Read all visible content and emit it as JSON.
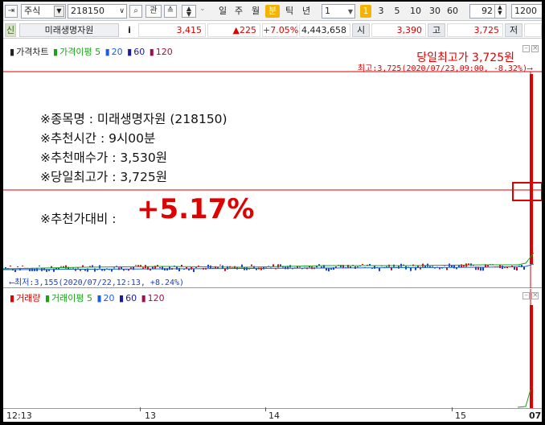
{
  "toolbar": {
    "market_type": "주식",
    "stock_code": "218150",
    "btn_gwan": "관",
    "periods": [
      "일",
      "주",
      "월",
      "분",
      "틱",
      "년"
    ],
    "active_period": "분",
    "interval_value": "1",
    "intervals": [
      "1",
      "3",
      "5",
      "10",
      "30",
      "60"
    ],
    "active_interval": "1",
    "zoom_value": "92",
    "count_value": "1200"
  },
  "quote": {
    "badge": "신",
    "stock_name": "미래생명자원",
    "info_icon": "i",
    "current_price": "3,415",
    "change": "▲225",
    "change_pct": "+7.05%",
    "volume": "4,443,658",
    "open_label": "시",
    "open_price": "3,390",
    "high_label": "고",
    "high_price": "3,725",
    "low_label": "저"
  },
  "price_pane": {
    "legend": [
      {
        "text": "가격차트",
        "color": "#222222"
      },
      {
        "text": "가격이평 5",
        "color": "#18a418"
      },
      {
        "text": "20",
        "color": "#1c5fd6"
      },
      {
        "text": "60",
        "color": "#1a1aa0"
      },
      {
        "text": "120",
        "color": "#a0104e"
      }
    ],
    "high_banner": "당일최고가 3,725원",
    "high_note": "최고:3,725(2020/07/23,09:00, -8.32%)⟶",
    "low_note": "⟵최저:3,155(2020/07/22,12:13, +8.24%)"
  },
  "info_text": {
    "line1": "※종목명 : 미래생명자원 (218150)",
    "line2": "※추천시간 : 9시00분",
    "line3": "※추천매수가 : 3,530원",
    "line4": "※당일최고가 : 3,725원",
    "line5_label": "※추천가대비 :",
    "line5_value": "+5.17%"
  },
  "volume_pane": {
    "legend": [
      {
        "text": "거래량",
        "color": "#e00000"
      },
      {
        "text": "거래이평 5",
        "color": "#18a418"
      },
      {
        "text": "20",
        "color": "#1c5fd6"
      },
      {
        "text": "60",
        "color": "#1a1aa0"
      },
      {
        "text": "120",
        "color": "#a0104e"
      }
    ]
  },
  "time_axis": [
    "12:13",
    "13",
    "14",
    "15",
    "07"
  ],
  "colors": {
    "accent_red": "#e00000",
    "active_yellow": "#f5b200",
    "up_color": "#e00000",
    "down_color": "#1a3fc8"
  }
}
